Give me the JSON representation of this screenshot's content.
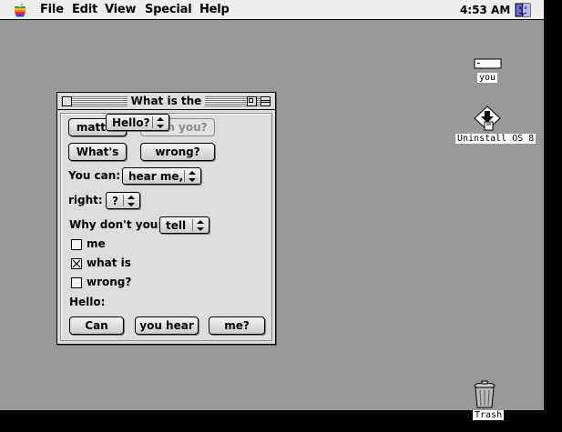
{
  "menubar": {
    "apple_icon": "apple-icon",
    "items": [
      "File",
      "Edit",
      "View",
      "Special",
      "Help"
    ],
    "clock": "4:53 AM",
    "app_icon": "finder-icon"
  },
  "desktop": {
    "icons": [
      {
        "label": "you",
        "icon": "drive-icon"
      },
      {
        "label": "Uninstall OS 8",
        "icon": "installer-icon"
      },
      {
        "label": "Trash",
        "icon": "trash-icon"
      }
    ]
  },
  "window": {
    "title": "What is the",
    "buttons": {
      "matter": "matter",
      "with_you": "with you?",
      "whats": "What's",
      "wrong": "wrong?",
      "can": "Can",
      "you_hear": "you hear",
      "me": "me?"
    },
    "you_can": {
      "label": "You can:",
      "value": "hear me,"
    },
    "right": {
      "label": "right:",
      "value": "?"
    },
    "why_dont_you": {
      "label": "Why don't you:",
      "value": "tell"
    },
    "checkboxes": [
      {
        "label": "me",
        "checked": false
      },
      {
        "label": "what is",
        "checked": true
      },
      {
        "label": "wrong?",
        "checked": false
      }
    ],
    "hello": {
      "label": "Hello:",
      "value": "Hello?"
    }
  },
  "colors": {
    "desktop": "#999999",
    "window_bg": "#dddddd",
    "menubar_bg": "#eeeeee",
    "disabled_text": "#8a8a8a"
  }
}
